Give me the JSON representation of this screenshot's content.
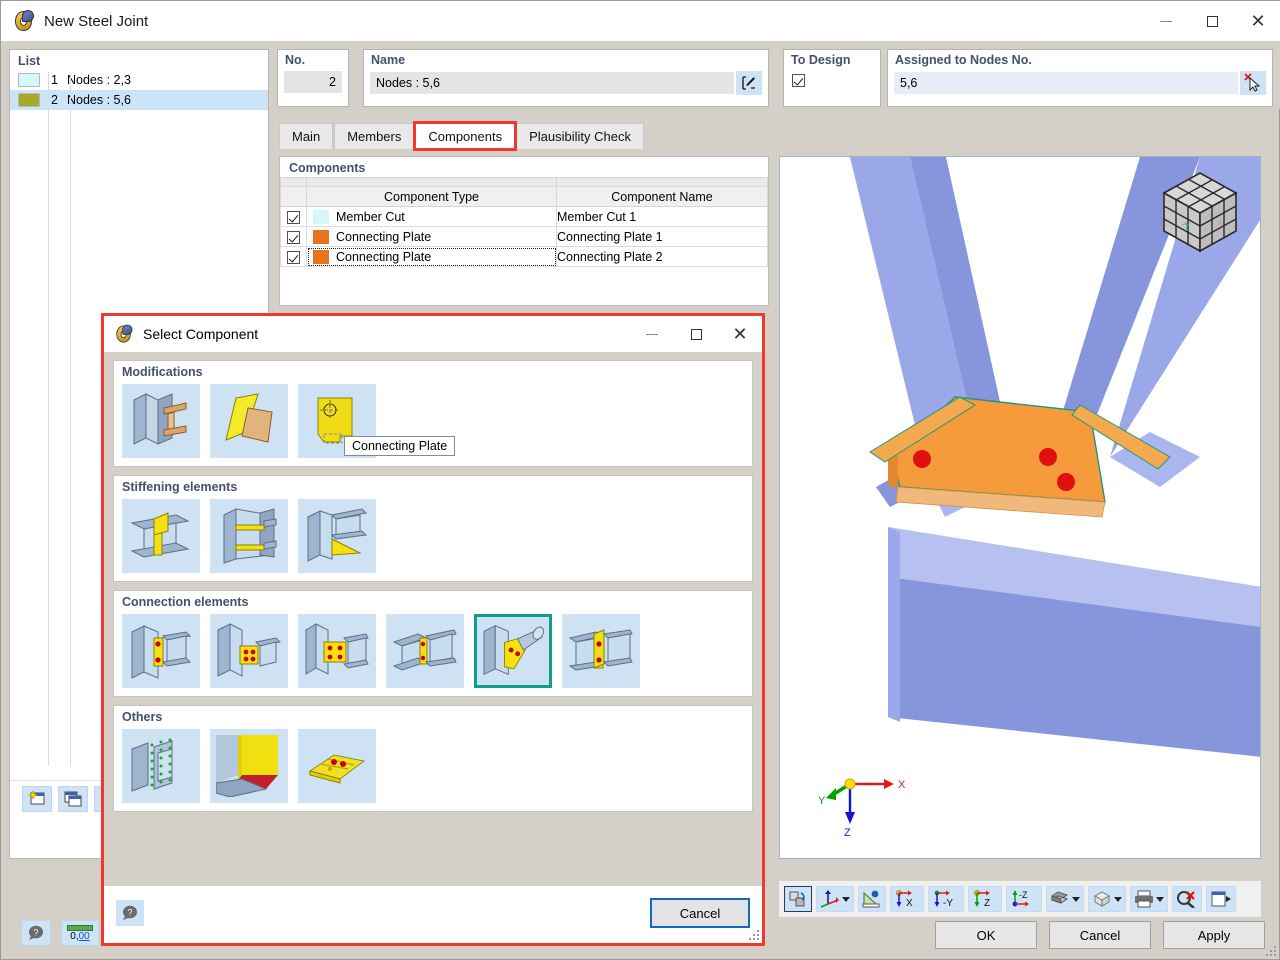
{
  "window": {
    "title": "New Steel Joint",
    "icon": "steel-joint-icon",
    "minimize": "—",
    "maximize": "□",
    "close": "✕"
  },
  "list_panel": {
    "label": "List",
    "rows": [
      {
        "num": "1",
        "name": "Nodes : 2,3",
        "color": "#d4f7f7",
        "selected": false
      },
      {
        "num": "2",
        "name": "Nodes : 5,6",
        "color": "#a8a82c",
        "selected": true
      }
    ],
    "toolbar": [
      {
        "name": "new-joint-button",
        "glyph": "❖"
      },
      {
        "name": "copy-joint-button",
        "glyph": "⧉"
      },
      {
        "name": "delete-joint-button",
        "glyph": "✖"
      }
    ],
    "toolbar2": [
      {
        "name": "help-button",
        "glyph": "?"
      },
      {
        "name": "units-button",
        "glyph": "0,00"
      },
      {
        "name": "settings-button",
        "glyph": "▤"
      }
    ]
  },
  "fields": {
    "no_label": "No.",
    "no_value": "2",
    "name_label": "Name",
    "name_value": "Nodes : 5,6",
    "name_edit_icon": "edit-pencil-icon",
    "to_design_label": "To Design",
    "to_design_checked": true,
    "assigned_label": "Assigned to Nodes No.",
    "assigned_value": "5,6",
    "assigned_pick_icon": "select-cursor-icon"
  },
  "tabs": [
    {
      "label": "Main",
      "active": false,
      "highlight": false
    },
    {
      "label": "Members",
      "active": false,
      "highlight": false
    },
    {
      "label": "Components",
      "active": true,
      "highlight": true
    },
    {
      "label": "Plausibility Check",
      "active": false,
      "highlight": false
    }
  ],
  "components_panel": {
    "title": "Components",
    "columns": [
      "",
      "Component Type",
      "Component Name"
    ],
    "rows": [
      {
        "checked": true,
        "color": "#d4f7f7",
        "type": "Member Cut",
        "name": "Member Cut 1",
        "focused": false
      },
      {
        "checked": true,
        "color": "#e8731e",
        "type": "Connecting Plate",
        "name": "Connecting Plate 1",
        "focused": false
      },
      {
        "checked": true,
        "color": "#e8731e",
        "type": "Connecting Plate",
        "name": "Connecting Plate 2",
        "focused": true
      }
    ]
  },
  "view3d": {
    "nav_cube": "navigation-cube",
    "axes": {
      "x": "X",
      "y": "Y",
      "z": "Z",
      "x_color": "#e01b1b",
      "y_color": "#00a000",
      "z_color": "#1414d2"
    },
    "model_colors": {
      "member": "#8e9ee8",
      "plate": "#f59b3c",
      "bolt": "#e01010"
    },
    "toolbar": [
      {
        "name": "rotate-view-button",
        "glyph": "↻",
        "active": true,
        "caret": false
      },
      {
        "name": "coordinate-system-button",
        "glyph": "⤴",
        "active": false,
        "caret": true
      },
      {
        "name": "measure-button",
        "glyph": "◢",
        "active": false,
        "caret": false
      },
      {
        "name": "view-in-x-button",
        "glyph": "X",
        "active": false,
        "caret": false
      },
      {
        "name": "view-in-negative-y-button",
        "glyph": "-Y",
        "active": false,
        "caret": false
      },
      {
        "name": "view-in-z-button",
        "glyph": "Z",
        "active": false,
        "caret": false
      },
      {
        "name": "view-in-negative-z-button",
        "glyph": "-Z",
        "active": false,
        "caret": false
      },
      {
        "name": "render-mode-button",
        "glyph": "◰",
        "active": false,
        "caret": true
      },
      {
        "name": "wireframe-button",
        "glyph": "⬡",
        "active": false,
        "caret": true
      },
      {
        "name": "print-button",
        "glyph": "⎙",
        "active": false,
        "caret": true
      },
      {
        "name": "zoom-reset-button",
        "glyph": "✕",
        "active": false,
        "caret": false
      },
      {
        "name": "panel-toggle-button",
        "glyph": "▶",
        "active": false,
        "caret": false
      }
    ]
  },
  "dialog": {
    "title": "Select Component",
    "icon": "steel-joint-icon",
    "minimize": "—",
    "maximize": "□",
    "close": "✕",
    "groups": [
      {
        "label": "Modifications",
        "items": [
          {
            "name": "member-cut-icon",
            "selected": false
          },
          {
            "name": "plate-cut-icon",
            "selected": false
          },
          {
            "name": "opening-icon",
            "selected": false
          }
        ]
      },
      {
        "label": "Stiffening elements",
        "items": [
          {
            "name": "web-stiffener-icon",
            "selected": false
          },
          {
            "name": "flange-stiffener-icon",
            "selected": false
          },
          {
            "name": "haunch-stiffener-icon",
            "selected": false
          }
        ]
      },
      {
        "label": "Connection elements",
        "items": [
          {
            "name": "end-plate-icon",
            "selected": false
          },
          {
            "name": "fin-plate-icon",
            "selected": false
          },
          {
            "name": "bolted-plate-icon",
            "selected": false
          },
          {
            "name": "web-splice-icon",
            "selected": false
          },
          {
            "name": "connecting-plate-icon",
            "selected": true
          },
          {
            "name": "angle-cleat-icon",
            "selected": false
          }
        ]
      },
      {
        "label": "Others",
        "items": [
          {
            "name": "welds-icon",
            "selected": false
          },
          {
            "name": "contact-icon",
            "selected": false
          },
          {
            "name": "base-plate-icon",
            "selected": false
          }
        ]
      }
    ],
    "tooltip": "Connecting Plate",
    "help_icon": "help-icon",
    "cancel_label": "Cancel"
  },
  "footer": {
    "ok_label": "OK",
    "cancel_label": "Cancel",
    "apply_label": "Apply"
  }
}
